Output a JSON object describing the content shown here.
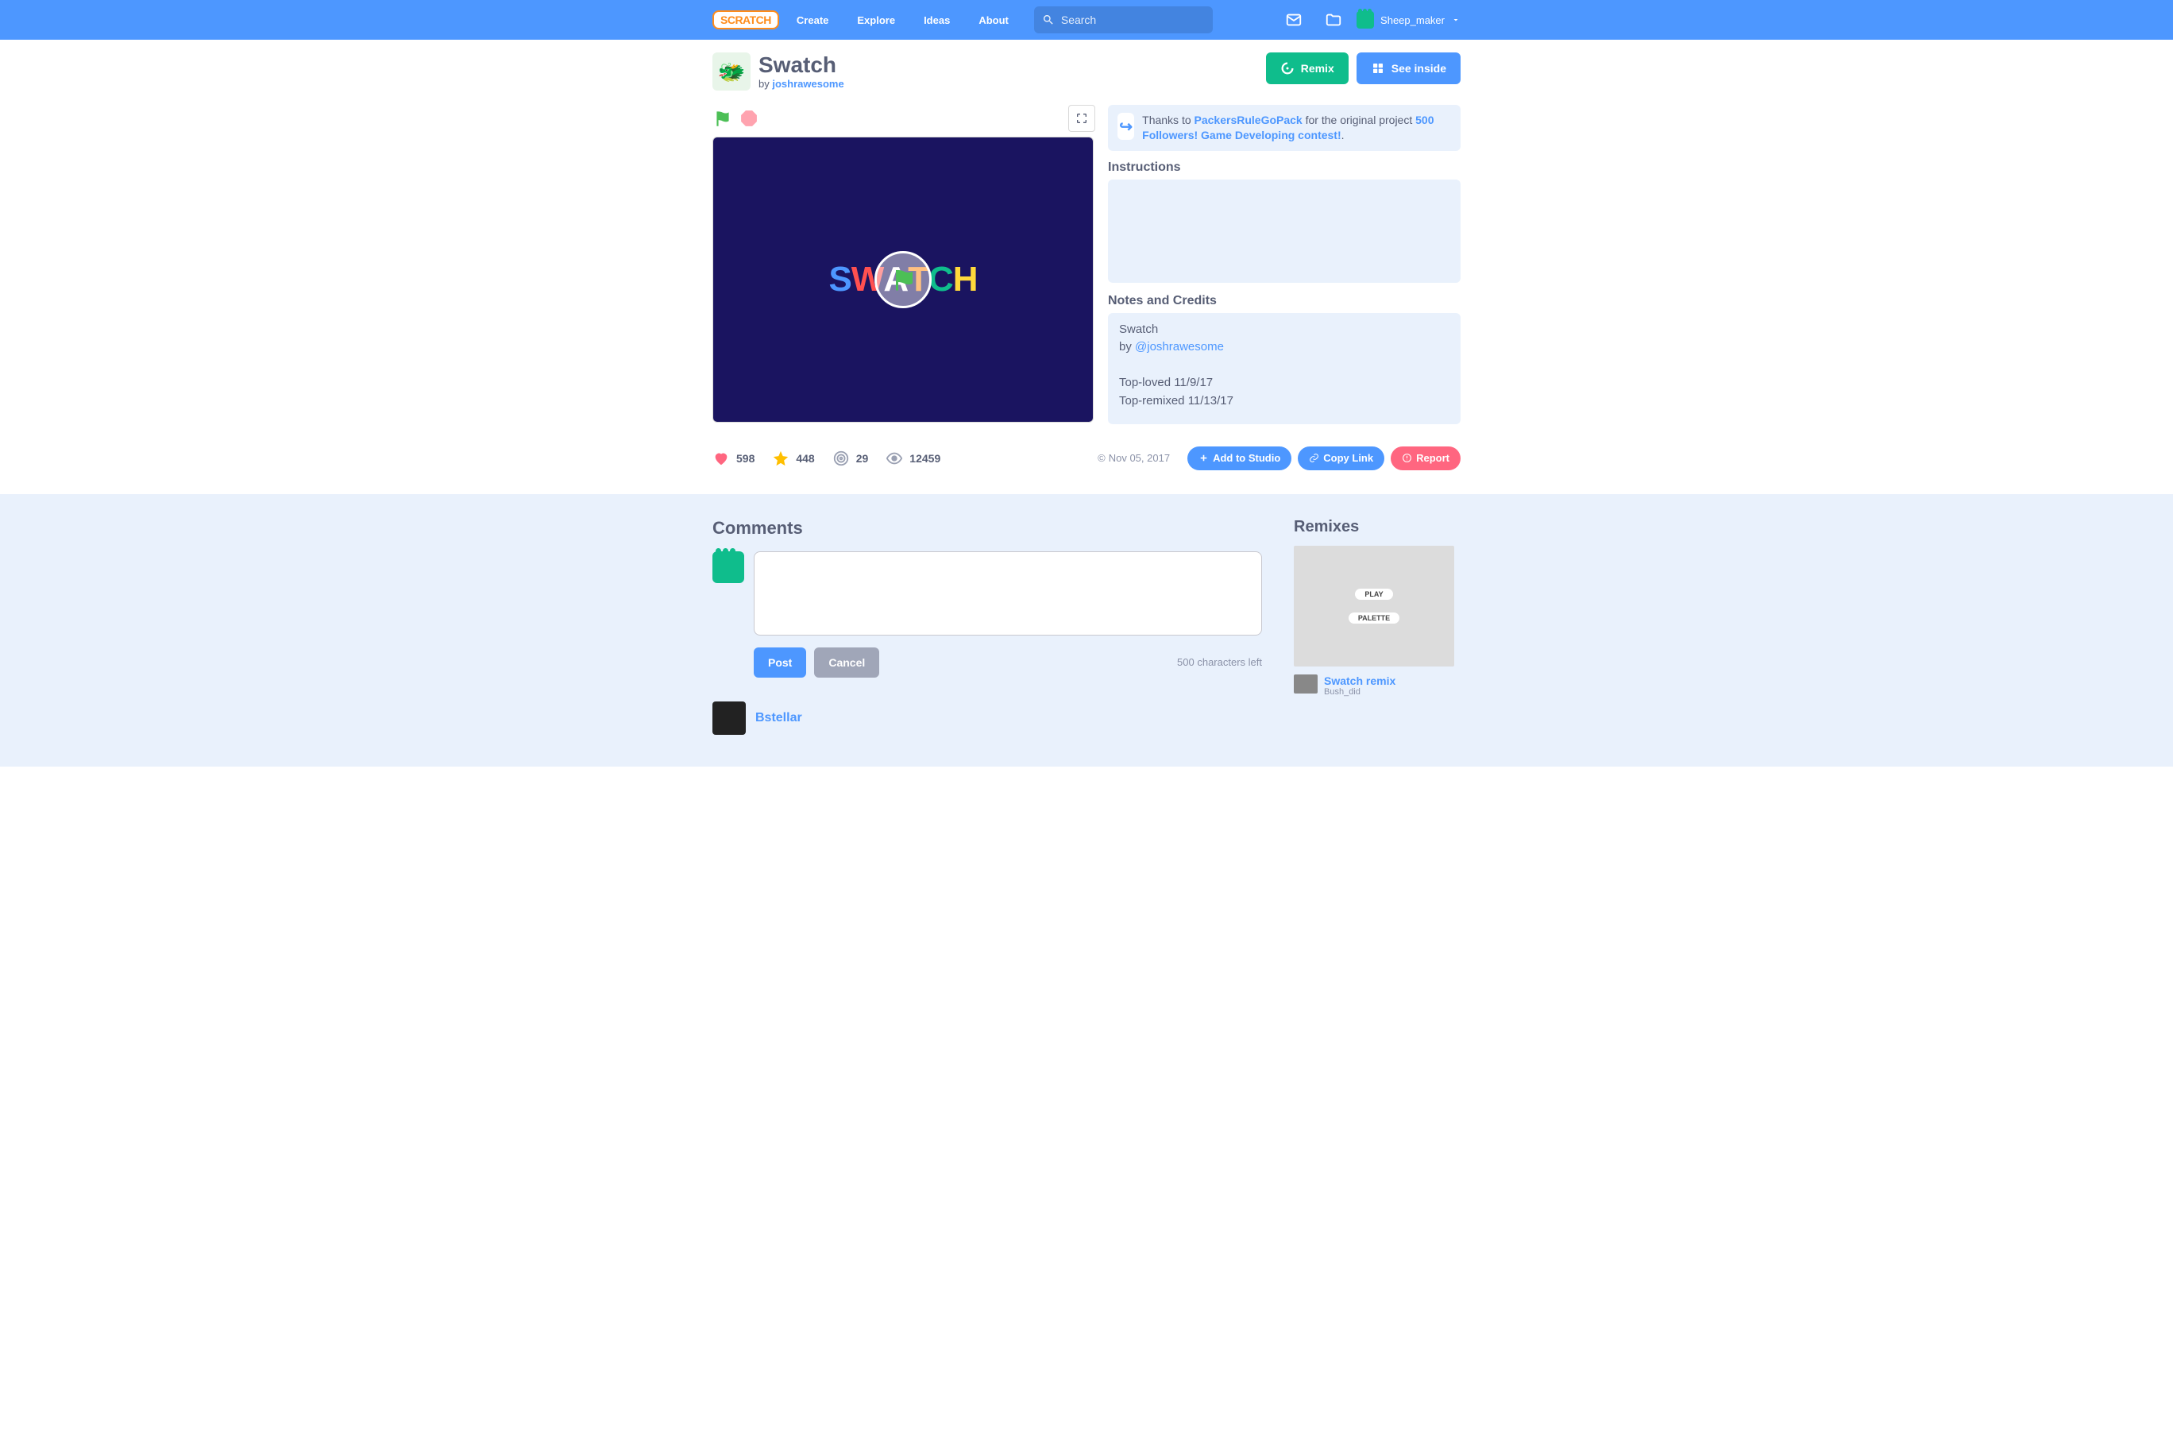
{
  "nav": {
    "logo": "SCRATCH",
    "links": {
      "create": "Create",
      "explore": "Explore",
      "ideas": "Ideas",
      "about": "About"
    },
    "search_placeholder": "Search",
    "username": "Sheep_maker"
  },
  "project": {
    "title": "Swatch",
    "by_label": "by",
    "author": "joshrawesome",
    "stage_letters": [
      "S",
      "W",
      "A",
      "T",
      "C",
      "H"
    ]
  },
  "buttons": {
    "remix": "Remix",
    "see_inside": "See inside",
    "add_to_studio": "Add to Studio",
    "copy_link": "Copy Link",
    "report": "Report",
    "post": "Post",
    "cancel": "Cancel"
  },
  "remix_credit": {
    "prefix": "Thanks to ",
    "user": "PackersRuleGoPack",
    "middle": " for the original project ",
    "project": "500 Followers! Game Developing contest!",
    "suffix": "."
  },
  "sections": {
    "instructions": "Instructions",
    "notes": "Notes and Credits",
    "comments": "Comments",
    "remixes": "Remixes"
  },
  "notes": {
    "line1": "Swatch",
    "by_prefix": "by ",
    "author_handle": "@joshrawesome",
    "line3": "Top-loved 11/9/17",
    "line4": "Top-remixed 11/13/17"
  },
  "stats": {
    "loves": "598",
    "favorites": "448",
    "remixes": "29",
    "views": "12459",
    "date": "Nov 05, 2017"
  },
  "compose": {
    "counter": "500 characters left"
  },
  "comments": [
    {
      "username": "Bstellar"
    }
  ],
  "remixes": {
    "thumb_tags": [
      "PLAY",
      "PALETTE"
    ],
    "items": [
      {
        "title": "Swatch remix",
        "author": "Bush_did"
      }
    ]
  }
}
